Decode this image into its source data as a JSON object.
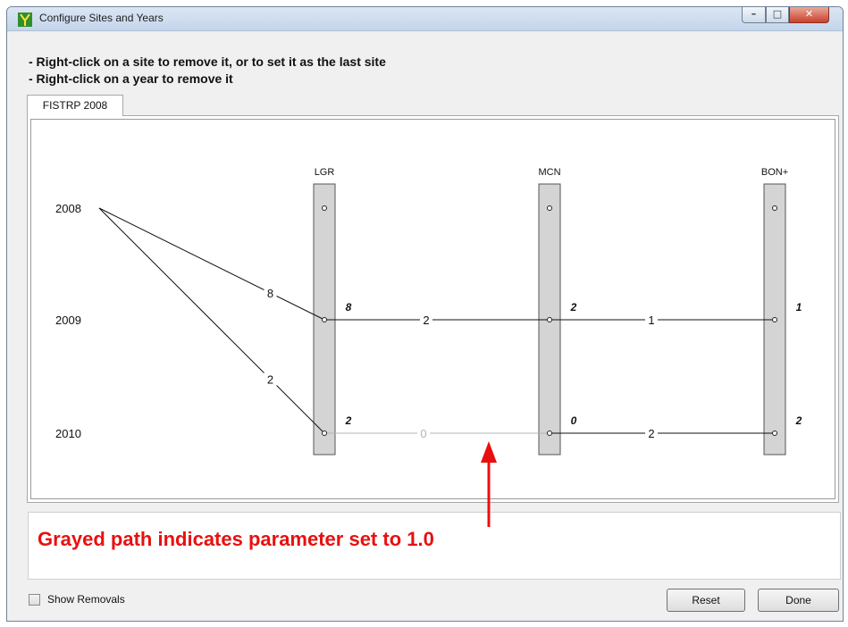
{
  "window": {
    "title": "Configure Sites and Years",
    "controls": {
      "minimize": "–",
      "maximize": "□",
      "close": "✕"
    }
  },
  "instructions": [
    "- Right-click on a site to remove it, or to set it as the last site",
    "- Right-click on a year to remove it"
  ],
  "tabs": [
    {
      "label": "FISTRP 2008"
    }
  ],
  "diagram": {
    "years": [
      "2008",
      "2009",
      "2010"
    ],
    "sites": [
      "LGR",
      "MCN",
      "BON+"
    ],
    "site_counts": {
      "LGR": [
        "8",
        "2"
      ],
      "MCN": [
        "2",
        "0"
      ],
      "BON+": [
        "1",
        "2"
      ]
    },
    "release_edges": [
      {
        "from": "2008",
        "to": "LGR-2009",
        "label": "8"
      },
      {
        "from": "2008",
        "to": "LGR-2010",
        "label": "2"
      }
    ],
    "path_edges": [
      {
        "from": "LGR-2009",
        "to": "MCN-2009",
        "label": "2",
        "grayed": false
      },
      {
        "from": "MCN-2009",
        "to": "BON+-2009",
        "label": "1",
        "grayed": false
      },
      {
        "from": "LGR-2010",
        "to": "MCN-2010",
        "label": "0",
        "grayed": true
      },
      {
        "from": "MCN-2010",
        "to": "BON+-2010",
        "label": "2",
        "grayed": false
      }
    ]
  },
  "annotation": {
    "text": "Grayed path indicates parameter set to 1.0",
    "color": "#e8100f"
  },
  "footer": {
    "show_removals_label": "Show Removals",
    "show_removals_checked": false,
    "reset_label": "Reset",
    "done_label": "Done"
  },
  "colors": {
    "grayed_path": "#b4b4b4",
    "site_bar": "#d4d4d4"
  }
}
